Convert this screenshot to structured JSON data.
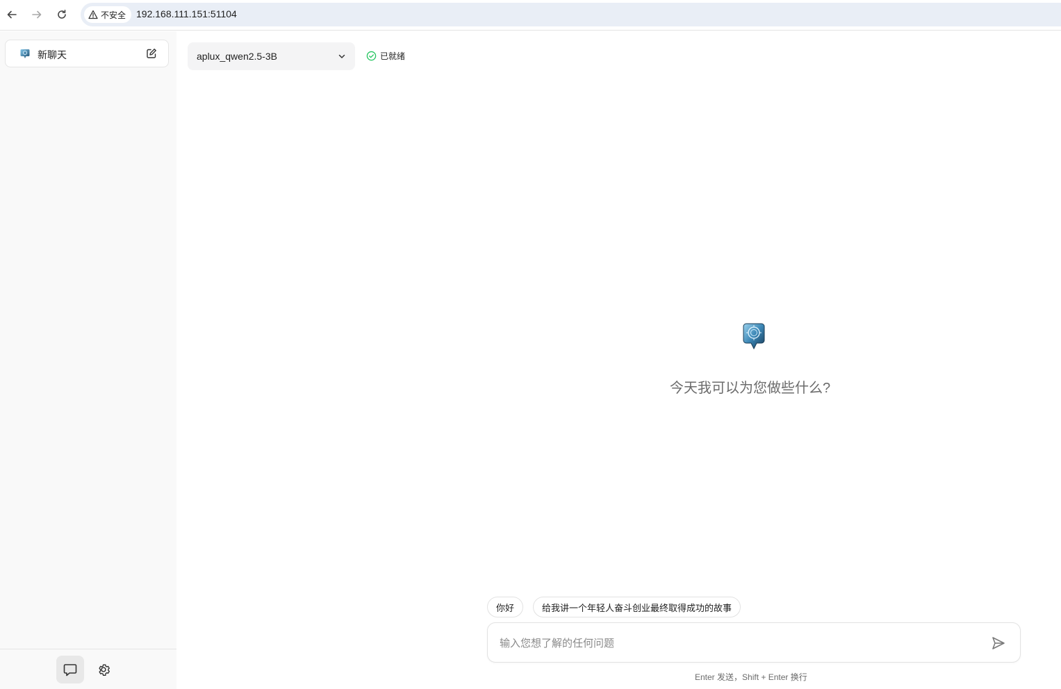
{
  "browser": {
    "security_label": "不安全",
    "url": "192.168.111.151:51104",
    "icons": [
      "back-arrow-icon",
      "forward-arrow-icon",
      "reload-icon",
      "warning-icon"
    ]
  },
  "sidebar": {
    "new_chat_label": "新聊天",
    "footer_buttons": [
      "chat-icon",
      "gear-icon"
    ]
  },
  "header": {
    "model": "aplux_qwen2.5-3B",
    "status": "已就绪",
    "status_color": "#22c55e"
  },
  "main": {
    "greeting": "今天我可以为您做些什么?",
    "suggestions": [
      "你好",
      "给我讲一个年轻人奋斗创业最终取得成功的故事"
    ],
    "input_placeholder": "输入您想了解的任何问题",
    "hint": "Enter 发送，Shift + Enter 换行"
  }
}
